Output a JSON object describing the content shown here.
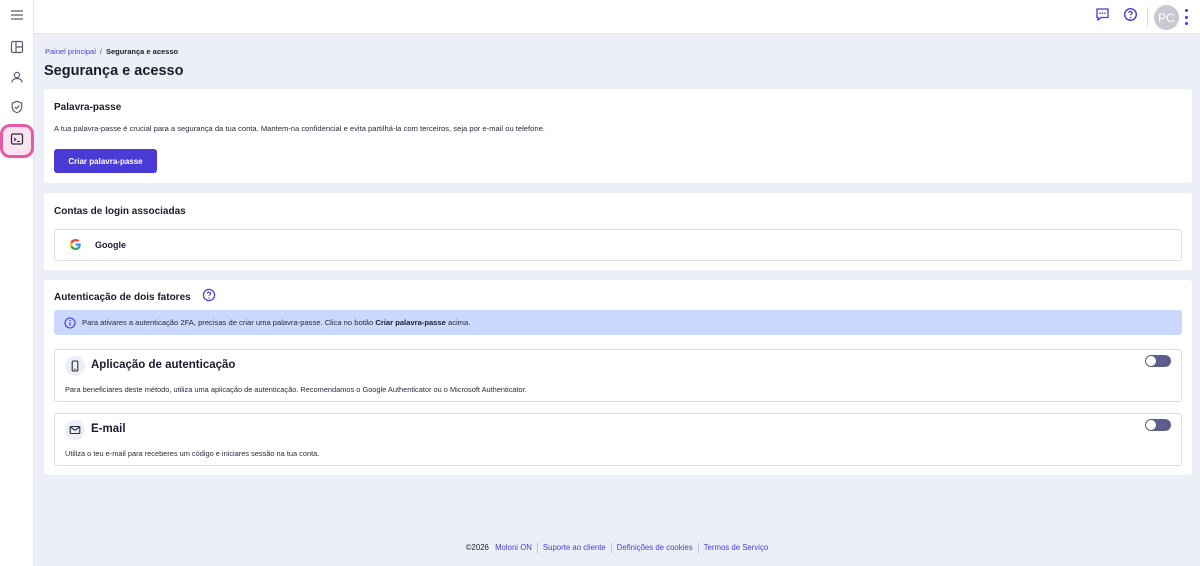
{
  "topbar": {
    "menu_icon": "hamburger-icon",
    "chat_icon": "chat-icon",
    "help_icon": "help-icon",
    "avatar_initials": "PC",
    "more_icon": "kebab-icon"
  },
  "sidebar": {
    "items": [
      {
        "name": "dashboard",
        "icon": "dashboard-icon"
      },
      {
        "name": "profile",
        "icon": "user-icon"
      },
      {
        "name": "security",
        "icon": "shield-icon"
      },
      {
        "name": "sessions",
        "icon": "terminal-icon"
      }
    ]
  },
  "breadcrumb": {
    "home": "Painel principal",
    "separator": "/",
    "current": "Segurança e acesso"
  },
  "page": {
    "title": "Segurança e acesso"
  },
  "password": {
    "title": "Palavra-passe",
    "description": "A tua palavra-passe é crucial para a segurança da tua conta. Mantem-na confidencial e evita partilhá-la com terceiros, seja por e-mail ou telefone.",
    "button": "Criar palavra-passe"
  },
  "linked_accounts": {
    "title": "Contas de login associadas",
    "items": [
      {
        "label": "Google",
        "icon": "google-icon"
      }
    ]
  },
  "two_factor": {
    "title": "Autenticação de dois fatores",
    "info_prefix": "Para ativares a autenticação 2FA, precisas de criar uma palavra-passe. Clica no botão ",
    "info_bold": "Criar palavra-passe",
    "info_suffix": " acima.",
    "methods": [
      {
        "title": "Aplicação de autenticação",
        "description": "Para beneficiares deste método, utiliza uma aplicação de autenticação. Recomendamos o Google Authenticator ou o Microsoft Authenticator.",
        "icon": "smartphone-icon",
        "enabled": false
      },
      {
        "title": "E-mail",
        "description": "Utiliza o teu e-mail para receberes um código e iniciares sessão na tua conta.",
        "icon": "mail-icon",
        "enabled": false
      }
    ]
  },
  "footer": {
    "copyright": "©2026",
    "links": [
      "Moloni ON",
      "Suporte ao cliente",
      "Definições de cookies",
      "Termos de Serviço"
    ]
  },
  "colors": {
    "accent": "#4b3bd6",
    "page_bg": "#eceef8",
    "info_bg": "#c9d8fb",
    "highlight": "#e55aa6"
  }
}
